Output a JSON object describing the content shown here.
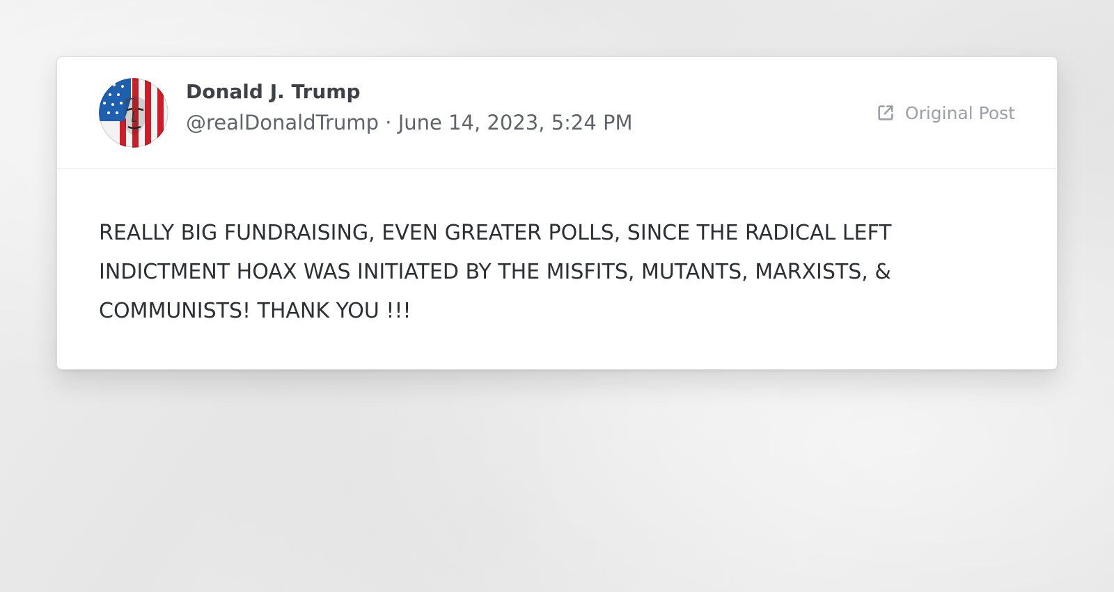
{
  "post": {
    "author_name": "Donald J. Trump",
    "author_handle": "@realDonaldTrump",
    "separator": " · ",
    "timestamp": "June 14, 2023, 5:24 PM",
    "original_post_label": "Original Post",
    "body": "REALLY BIG FUNDRAISING, EVEN GREATER POLLS, SINCE THE RADICAL LEFT INDICTMENT HOAX WAS INITIATED BY THE MISFITS, MUTANTS, MARXISTS, & COMMUNISTS! THANK YOU !!!"
  },
  "icons": {
    "avatar": "flag-portrait-avatar",
    "original_post": "external-link-icon"
  },
  "colors": {
    "background": "#ececec",
    "card": "#ffffff",
    "author_name": "#3e4147",
    "meta_text": "#5f646b",
    "link_gray": "#9c9fa5",
    "body_text": "#2c2f33",
    "flag_red": "#c8202a",
    "flag_blue": "#1f5fb0"
  }
}
